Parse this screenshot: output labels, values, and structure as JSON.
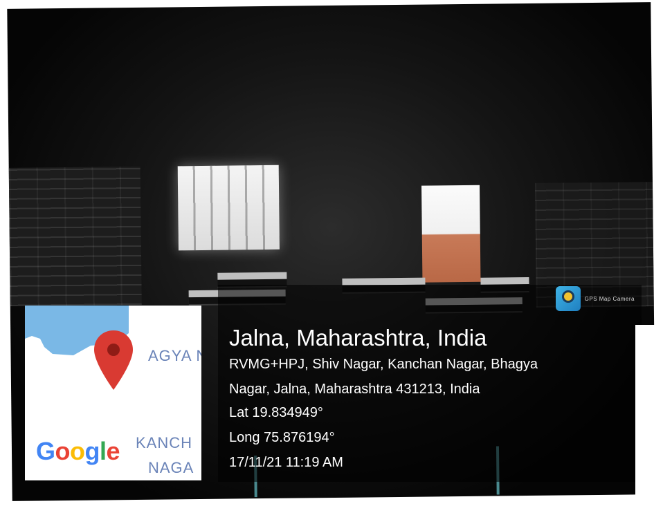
{
  "map": {
    "labels": [
      "AGYA N",
      "KANCH",
      "NAGA"
    ],
    "logo_letters": [
      "G",
      "o",
      "o",
      "g",
      "l",
      "e"
    ]
  },
  "badge": {
    "label": "GPS Map Camera"
  },
  "location": {
    "title": "Jalna, Maharashtra, India",
    "address_line1": "RVMG+HPJ, Shiv Nagar, Kanchan Nagar, Bhagya",
    "address_line2": "Nagar, Jalna, Maharashtra 431213, India",
    "lat": "Lat 19.834949°",
    "long": "Long 75.876194°",
    "datetime": "17/11/21 11:19 AM"
  },
  "colors": {
    "map_water": "#7ab8e6",
    "pin_red": "#d93a32",
    "map_text": "#6b84b8"
  }
}
